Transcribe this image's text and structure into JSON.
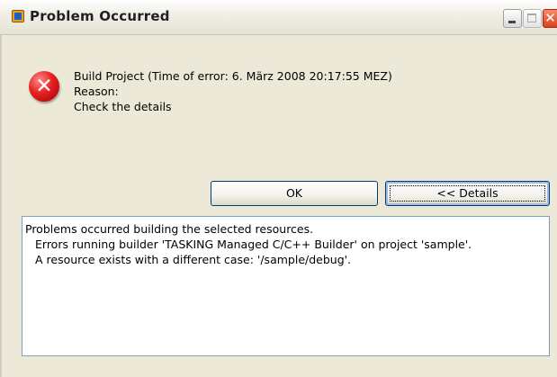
{
  "window": {
    "title": "Problem Occurred",
    "close_glyph": "✕"
  },
  "message": {
    "line1": "Build Project (Time of error: 6. März 2008 20:17:55 MEZ)",
    "line2": "Reason:",
    "line3": "Check the details"
  },
  "buttons": {
    "ok_label": "OK",
    "details_label": "<< Details"
  },
  "details": {
    "lines": [
      "Problems occurred building the selected resources.",
      "Errors running builder 'TASKING Managed C/C++ Builder' on project 'sample'.",
      "A resource exists with a different case: '/sample/debug'."
    ]
  },
  "icons": {
    "error": "error-icon",
    "app": "app-icon"
  }
}
